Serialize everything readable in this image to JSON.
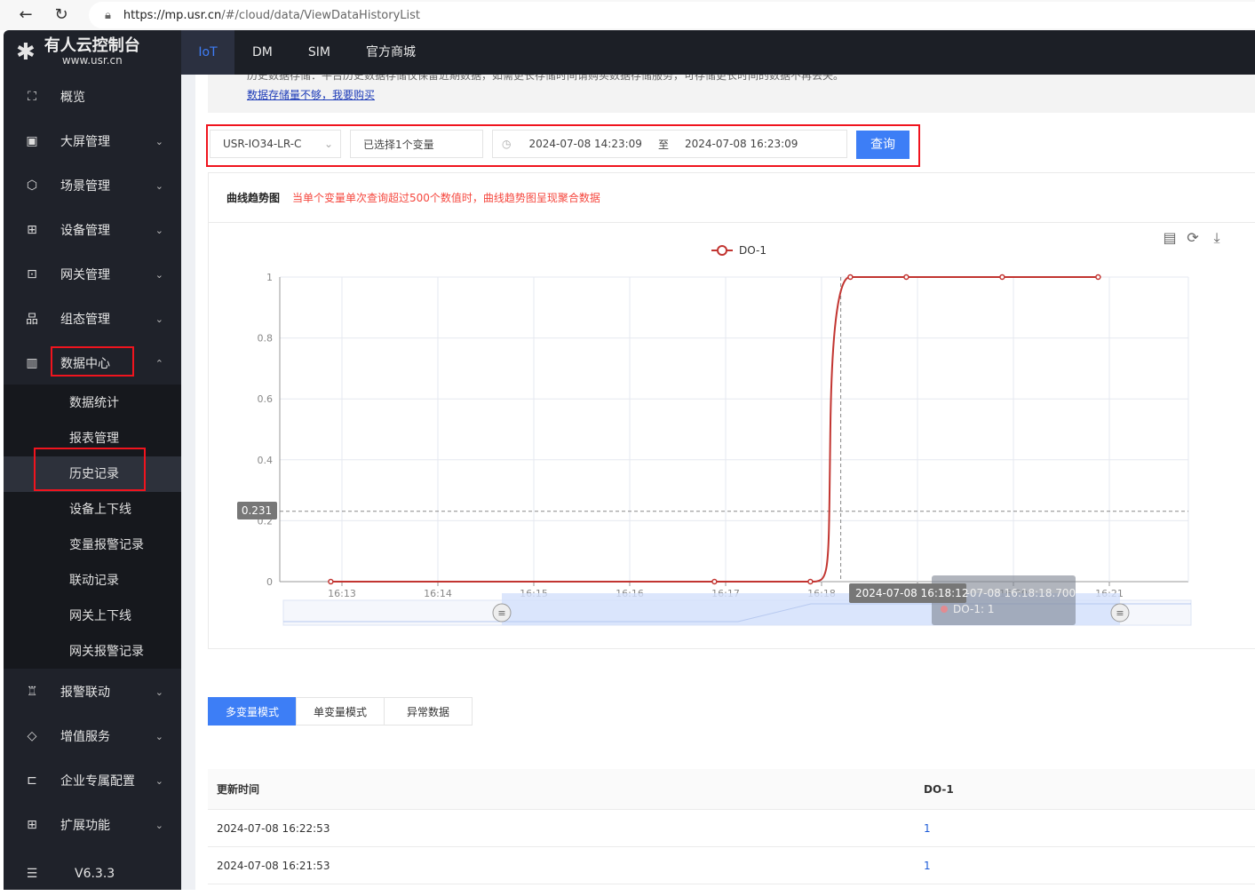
{
  "browser": {
    "url_host": "https://mp.usr.cn",
    "url_path": "/#/cloud/data/ViewDataHistoryList"
  },
  "logo": {
    "title": "有人云控制台",
    "subtitle": "www.usr.cn"
  },
  "topnav": [
    "IoT",
    "DM",
    "SIM",
    "官方商城"
  ],
  "sidebar": {
    "items": [
      {
        "label": "概览",
        "icon": "overview-icon",
        "glyph": "⛶"
      },
      {
        "label": "大屏管理",
        "icon": "screen-icon",
        "glyph": "▣",
        "chev": "⌄"
      },
      {
        "label": "场景管理",
        "icon": "scene-icon",
        "glyph": "⬡",
        "chev": "⌄"
      },
      {
        "label": "设备管理",
        "icon": "device-icon",
        "glyph": "⊞",
        "chev": "⌄"
      },
      {
        "label": "网关管理",
        "icon": "gateway-icon",
        "glyph": "⊡",
        "chev": "⌄"
      },
      {
        "label": "组态管理",
        "icon": "config-icon",
        "glyph": "品",
        "chev": "⌄"
      },
      {
        "label": "数据中心",
        "icon": "bar-chart-icon",
        "glyph": "▥",
        "chev": "⌃"
      }
    ],
    "sub": [
      "数据统计",
      "报表管理",
      "历史记录",
      "设备上下线",
      "变量报警记录",
      "联动记录",
      "网关上下线",
      "网关报警记录"
    ],
    "items2": [
      {
        "label": "报警联动",
        "icon": "alarm-icon",
        "glyph": "♖",
        "chev": "⌄"
      },
      {
        "label": "增值服务",
        "icon": "diamond-icon",
        "glyph": "◇",
        "chev": "⌄"
      },
      {
        "label": "企业专属配置",
        "icon": "enterprise-icon",
        "glyph": "⊏",
        "chev": "⌄"
      },
      {
        "label": "扩展功能",
        "icon": "grid-icon",
        "glyph": "⊞",
        "chev": "⌄"
      }
    ],
    "version": "V6.3.3"
  },
  "notice": {
    "line1": "历史数据存储：平台历史数据存储仅保留近期数据，如需更长存储时间请购买数据存储服务，可存储更长时间的数据不再丢失。",
    "link": "数据存储量不够，我要购买"
  },
  "filter": {
    "device": "USR-IO34-LR-C",
    "variables": "已选择1个变量",
    "start": "2024-07-08 14:23:09",
    "sep": "至",
    "end": "2024-07-08 16:23:09",
    "query": "查询"
  },
  "panel": {
    "title": "曲线趋势图",
    "note": "当单个变量单次查询超过500个数值时，曲线趋势图呈现聚合数据"
  },
  "chart_data": {
    "type": "line",
    "legend": "top-center",
    "grid": true,
    "series": [
      {
        "name": "DO-1",
        "color": "#c23531",
        "x": [
          "16:12:53",
          "16:16:53",
          "16:17:53",
          "16:18:18",
          "16:18:53",
          "16:19:53",
          "16:20:53"
        ],
        "values": [
          0,
          0,
          0,
          1,
          1,
          1,
          1
        ]
      }
    ],
    "xticks": [
      "16:13",
      "16:14",
      "16:15",
      "16:16",
      "16:17",
      "16:18",
      "16:19",
      "16:20",
      "16:21"
    ],
    "yticks": [
      0,
      0.2,
      0.4,
      0.6,
      0.8,
      1
    ],
    "ylim": [
      0,
      1
    ],
    "crosshair": {
      "y_label": "0.231",
      "x_label": "2024-07-08 16:18:12"
    },
    "tooltip": {
      "title": "2024-07-08 16:18:18.700",
      "item": "DO-1: 1"
    },
    "toolbox": [
      "data-view-icon",
      "refresh-icon",
      "download-icon"
    ]
  },
  "tabs": [
    "多变量模式",
    "单变量模式",
    "异常数据"
  ],
  "table": {
    "headers": [
      "更新时间",
      "DO-1"
    ],
    "rows": [
      [
        "2024-07-08 16:22:53",
        "1"
      ],
      [
        "2024-07-08 16:21:53",
        "1"
      ]
    ]
  }
}
